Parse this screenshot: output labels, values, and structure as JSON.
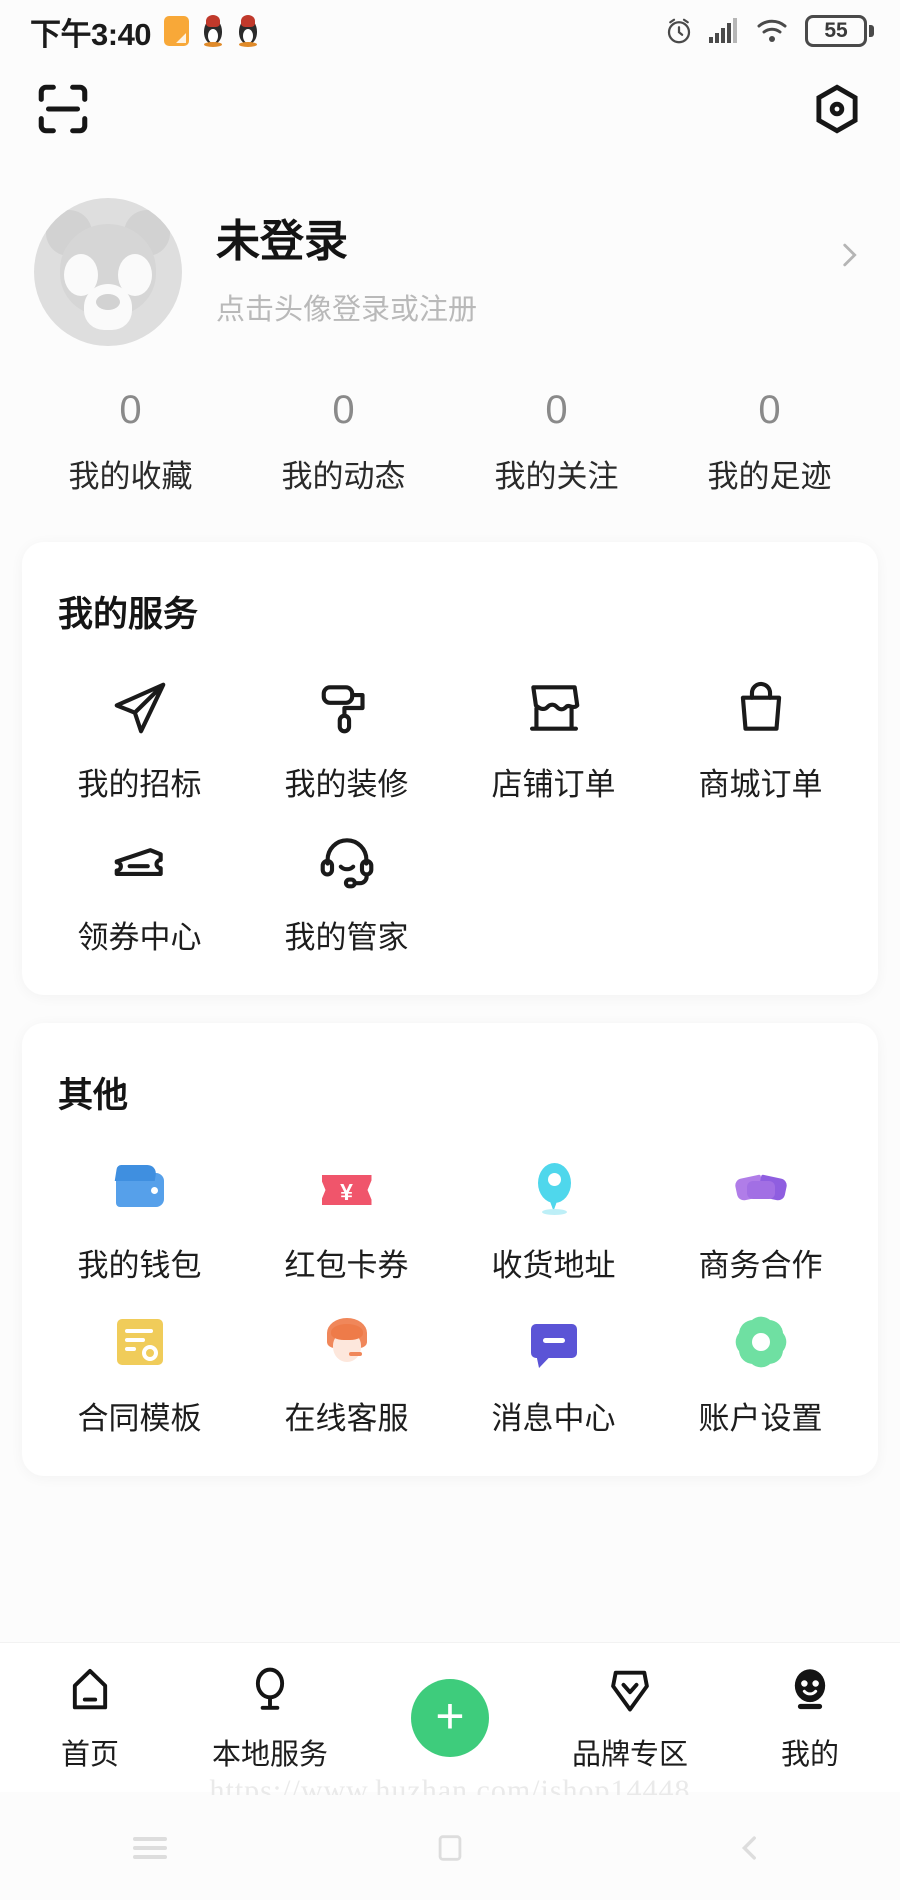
{
  "status_bar": {
    "time": "下午3:40",
    "battery_percent": "55",
    "icons": [
      "note-icon",
      "qq-penguin-icon",
      "qq-penguin-icon",
      "alarm-icon",
      "signal-icon",
      "wifi-icon",
      "battery-icon"
    ]
  },
  "app_bar": {
    "scan_icon": "scan-qr-icon",
    "settings_icon": "hexagon-dot-icon"
  },
  "profile": {
    "name": "未登录",
    "subtitle": "点击头像登录或注册",
    "avatar_icon": "panda-avatar-placeholder",
    "chevron_icon": "chevron-right-icon"
  },
  "stats": [
    {
      "value": "0",
      "label": "我的收藏"
    },
    {
      "value": "0",
      "label": "我的动态"
    },
    {
      "value": "0",
      "label": "我的关注"
    },
    {
      "value": "0",
      "label": "我的足迹"
    }
  ],
  "my_services": {
    "title": "我的服务",
    "items": [
      {
        "label": "我的招标",
        "icon": "paper-plane-icon"
      },
      {
        "label": "我的装修",
        "icon": "paint-roller-icon"
      },
      {
        "label": "店铺订单",
        "icon": "storefront-icon"
      },
      {
        "label": "商城订单",
        "icon": "shopping-bag-icon"
      },
      {
        "label": "领券中心",
        "icon": "coupon-ticket-icon"
      },
      {
        "label": "我的管家",
        "icon": "headset-icon"
      }
    ]
  },
  "other": {
    "title": "其他",
    "items": [
      {
        "label": "我的钱包",
        "icon": "wallet-icon",
        "color": "#56a0ea"
      },
      {
        "label": "红包卡券",
        "icon": "red-coupon-icon",
        "color": "#f0556b"
      },
      {
        "label": "收货地址",
        "icon": "location-pin-icon",
        "color": "#4fd7ec"
      },
      {
        "label": "商务合作",
        "icon": "handshake-icon",
        "color": "#8f5ee0"
      },
      {
        "label": "合同模板",
        "icon": "contract-document-icon",
        "color": "#f0cc5a"
      },
      {
        "label": "在线客服",
        "icon": "customer-service-agent-icon",
        "color": "#f0875a"
      },
      {
        "label": "消息中心",
        "icon": "message-bubble-icon",
        "color": "#5b54d6"
      },
      {
        "label": "账户设置",
        "icon": "gear-icon",
        "color": "#6fe0a2"
      }
    ]
  },
  "bottom_nav": {
    "items": [
      {
        "label": "首页",
        "icon": "home-icon",
        "active": false
      },
      {
        "label": "本地服务",
        "icon": "location-service-icon",
        "active": false
      },
      {
        "label": "",
        "icon": "plus-fab-icon",
        "active": false
      },
      {
        "label": "品牌专区",
        "icon": "brand-badge-icon",
        "active": false
      },
      {
        "label": "我的",
        "icon": "profile-filled-icon",
        "active": true
      }
    ],
    "fab_icon": "plus-icon",
    "accent_color": "#3ecc7c"
  },
  "watermark": "https://www.huzhan.com/ishop14448",
  "android_nav": {
    "recents_icon": "recents-icon",
    "home_icon": "home-square-icon",
    "back_icon": "back-chevron-icon"
  }
}
